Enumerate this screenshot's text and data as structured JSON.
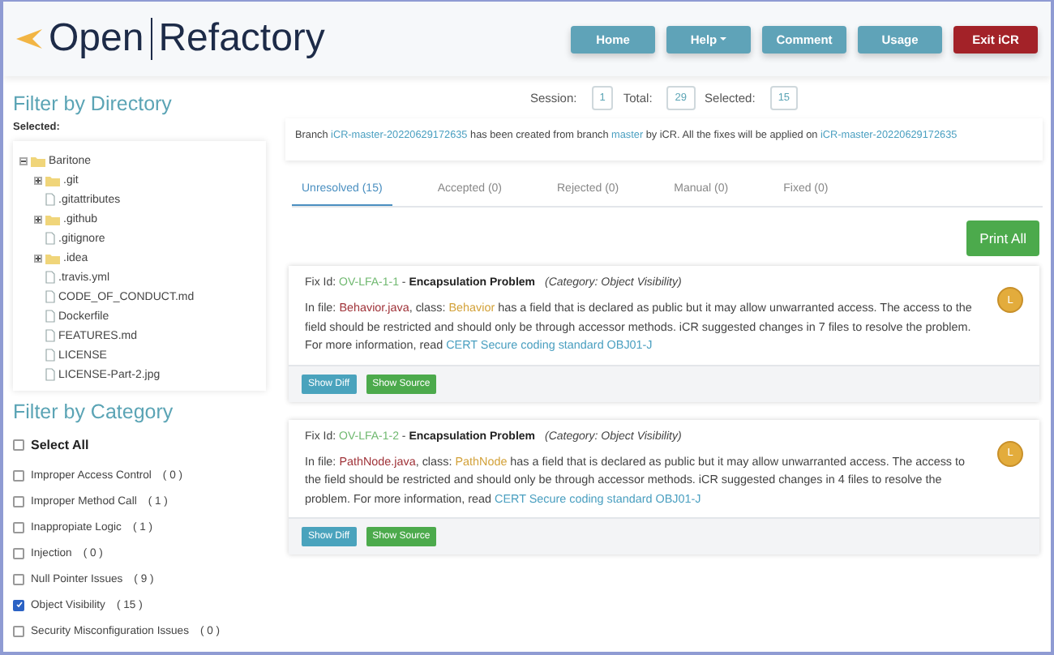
{
  "logo": {
    "parts": [
      "Open",
      "Refactory"
    ]
  },
  "nav": [
    {
      "label": "Home",
      "kind": "primary",
      "dropdown": false
    },
    {
      "label": "Help",
      "kind": "primary",
      "dropdown": true
    },
    {
      "label": "Comment",
      "kind": "primary",
      "dropdown": false
    },
    {
      "label": "Usage",
      "kind": "primary",
      "dropdown": false
    },
    {
      "label": "Exit iCR",
      "kind": "danger",
      "dropdown": false
    }
  ],
  "directory": {
    "title": "Filter by Directory",
    "selected_label": "Selected:",
    "tree": [
      {
        "name": "Baritone",
        "kind": "folder",
        "expanded": true,
        "children": [
          {
            "name": ".git",
            "kind": "folder",
            "expanded": false
          },
          {
            "name": ".gitattributes",
            "kind": "file"
          },
          {
            "name": ".github",
            "kind": "folder",
            "expanded": false
          },
          {
            "name": ".gitignore",
            "kind": "file"
          },
          {
            "name": ".idea",
            "kind": "folder",
            "expanded": false
          },
          {
            "name": ".travis.yml",
            "kind": "file"
          },
          {
            "name": "CODE_OF_CONDUCT.md",
            "kind": "file"
          },
          {
            "name": "Dockerfile",
            "kind": "file"
          },
          {
            "name": "FEATURES.md",
            "kind": "file"
          },
          {
            "name": "LICENSE",
            "kind": "file"
          },
          {
            "name": "LICENSE-Part-2.jpg",
            "kind": "file"
          }
        ]
      }
    ]
  },
  "category": {
    "title": "Filter by Category",
    "select_all": {
      "label": "Select All",
      "checked": false
    },
    "items": [
      {
        "label": "Improper Access Control",
        "count": "( 0 )",
        "checked": false
      },
      {
        "label": "Improper Method Call",
        "count": "( 1 )",
        "checked": false
      },
      {
        "label": "Inappropiate Logic",
        "count": "( 1 )",
        "checked": false
      },
      {
        "label": "Injection",
        "count": "( 0 )",
        "checked": false
      },
      {
        "label": "Null Pointer Issues",
        "count": "( 9 )",
        "checked": false
      },
      {
        "label": "Object Visibility",
        "count": "( 15 )",
        "checked": true
      },
      {
        "label": "Security Misconfiguration Issues",
        "count": "( 0 )",
        "checked": false
      }
    ]
  },
  "counters": [
    {
      "label": "Session:",
      "value": "1"
    },
    {
      "label": "Total:",
      "value": "29"
    },
    {
      "label": "Selected:",
      "value": "15"
    }
  ],
  "branch_message": [
    {
      "kind": "text",
      "text": "Branch "
    },
    {
      "kind": "link",
      "text": "iCR-master-20220629172635"
    },
    {
      "kind": "text",
      "text": " has been created from branch "
    },
    {
      "kind": "link",
      "text": "master"
    },
    {
      "kind": "text",
      "text": " by iCR. All the fixes will be applied on "
    },
    {
      "kind": "link",
      "text": "iCR-master-20220629172635"
    }
  ],
  "tabs": [
    {
      "label": "Unresolved (15)",
      "selected": true
    },
    {
      "label": "Accepted (0)",
      "selected": false
    },
    {
      "label": "Rejected (0)",
      "selected": false
    },
    {
      "label": "Manual (0)",
      "selected": false
    },
    {
      "label": "Fixed (0)",
      "selected": false
    }
  ],
  "print_button": "Print All",
  "fixes": [
    {
      "heading": [
        {
          "kind": "text",
          "text": "Fix Id: "
        },
        {
          "kind": "id",
          "text": "OV-LFA-1-1"
        },
        {
          "kind": "text",
          "text": " - "
        },
        {
          "kind": "title",
          "text": "Encapsulation Problem"
        },
        {
          "kind": "category",
          "text": "(Category: Object Visibility)"
        }
      ],
      "badge": "L",
      "description": [
        {
          "kind": "text",
          "text": "In file: "
        },
        {
          "kind": "file",
          "text": "Behavior.java"
        },
        {
          "kind": "text",
          "text": ", class: "
        },
        {
          "kind": "class",
          "text": "Behavior"
        },
        {
          "kind": "text",
          "text": " has a field that is declared as public but it may allow unwarranted access. The access to the field should be restricted and should only be through accessor methods. iCR suggested changes in 7 files to resolve the problem. For more information, read "
        },
        {
          "kind": "link",
          "text": "CERT Secure coding standard OBJ01-J"
        }
      ],
      "buttons": [
        {
          "label": "Show Diff",
          "kind": "info"
        },
        {
          "label": "Show Source",
          "kind": "success"
        }
      ]
    },
    {
      "heading": [
        {
          "kind": "text",
          "text": "Fix Id: "
        },
        {
          "kind": "id",
          "text": "OV-LFA-1-2"
        },
        {
          "kind": "text",
          "text": " - "
        },
        {
          "kind": "title",
          "text": "Encapsulation Problem"
        },
        {
          "kind": "category",
          "text": "(Category: Object Visibility)"
        }
      ],
      "badge": "L",
      "description": [
        {
          "kind": "text",
          "text": "In file: "
        },
        {
          "kind": "file",
          "text": "PathNode.java"
        },
        {
          "kind": "text",
          "text": ", class: "
        },
        {
          "kind": "class",
          "text": "PathNode"
        },
        {
          "kind": "text",
          "text": " has a field that is declared as public but it may allow unwarranted access. The access to the field should be restricted and should only be through accessor methods. iCR suggested changes in 4 files to resolve the problem. For more information, read "
        },
        {
          "kind": "link",
          "text": "CERT Secure coding standard OBJ01-J"
        }
      ],
      "buttons": [
        {
          "label": "Show Diff",
          "kind": "info"
        },
        {
          "label": "Show Source",
          "kind": "success"
        }
      ]
    }
  ]
}
